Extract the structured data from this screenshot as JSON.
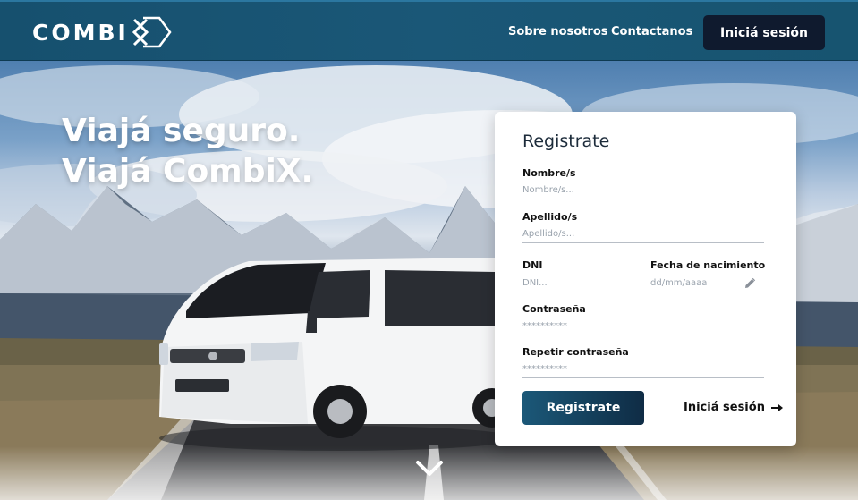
{
  "app": {
    "logo_text": "COMBI",
    "logo_mark": "X"
  },
  "navbar": {
    "about": "Sobre nosotros",
    "contact": "Contactanos",
    "login": "Iniciá sesión"
  },
  "hero": {
    "line1": "Viajá seguro.",
    "line2": "Viajá CombiX.",
    "scroll_icon": "chevron-down-icon"
  },
  "form": {
    "title": "Registrate",
    "fields": {
      "nombre": {
        "label": "Nombre/s",
        "placeholder": "Nombre/s..."
      },
      "apellido": {
        "label": "Apellido/s",
        "placeholder": "Apellido/s..."
      },
      "dni": {
        "label": "DNI",
        "placeholder": "DNI..."
      },
      "fecha": {
        "label": "Fecha de nacimiento",
        "placeholder": "dd/mm/aaaa"
      },
      "password": {
        "label": "Contraseña",
        "placeholder": "**********"
      },
      "password2": {
        "label": "Repetir contraseña",
        "placeholder": "**********"
      }
    },
    "submit": "Registrate",
    "login_link": "Iniciá sesión",
    "login_icon": "arrow-right-icon",
    "date_icon": "pencil-icon"
  },
  "colors": {
    "navbar": "#175470",
    "button_dark": "#0f1a2e",
    "accent": "#1b5878"
  }
}
